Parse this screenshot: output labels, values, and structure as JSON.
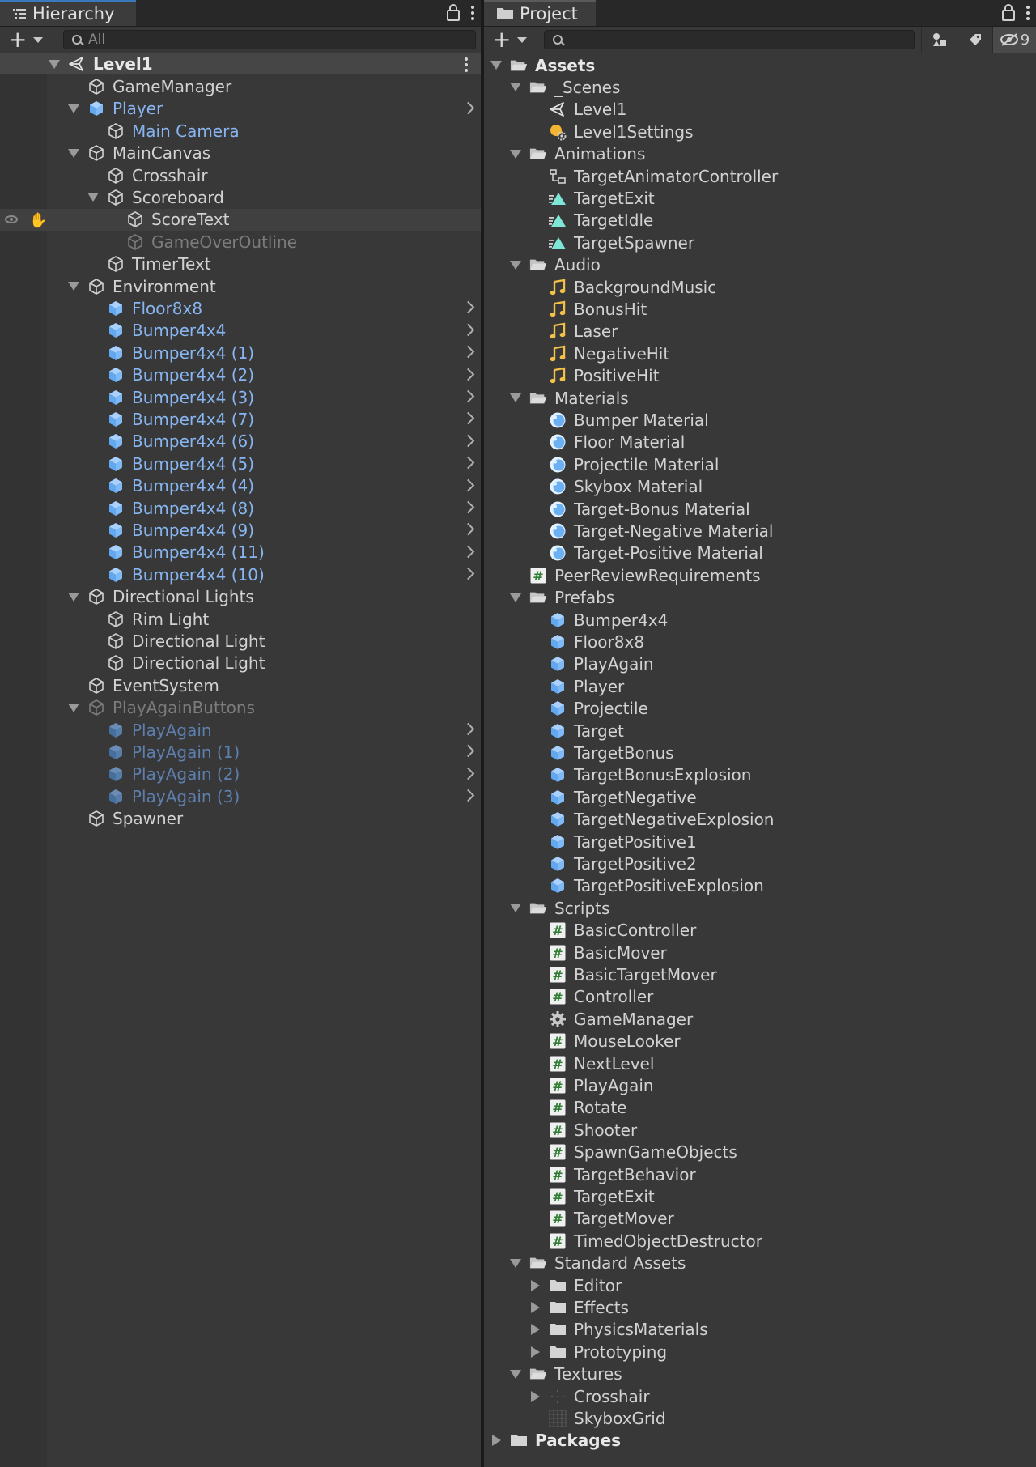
{
  "hierarchy": {
    "tab_label": "Hierarchy",
    "search_placeholder": "All",
    "rows": [
      {
        "label": "Level1",
        "depth": 0,
        "fold": "open",
        "icon": "unity-scene-icon",
        "style": "bold",
        "root": true
      },
      {
        "label": "GameManager",
        "depth": 1,
        "fold": "none",
        "icon": "cube-icon",
        "style": "normal"
      },
      {
        "label": "Player",
        "depth": 1,
        "fold": "open",
        "icon": "prefab-icon",
        "style": "prefab",
        "chevron": true
      },
      {
        "label": "Main Camera",
        "depth": 2,
        "fold": "none",
        "icon": "cube-icon",
        "style": "prefab"
      },
      {
        "label": "MainCanvas",
        "depth": 1,
        "fold": "open",
        "icon": "cube-icon",
        "style": "normal"
      },
      {
        "label": "Crosshair",
        "depth": 2,
        "fold": "none",
        "icon": "cube-icon",
        "style": "normal"
      },
      {
        "label": "Scoreboard",
        "depth": 2,
        "fold": "open",
        "icon": "cube-icon",
        "style": "normal"
      },
      {
        "label": "ScoreText",
        "depth": 3,
        "fold": "none",
        "icon": "cube-icon",
        "style": "normal",
        "hover": true
      },
      {
        "label": "GameOverOutline",
        "depth": 3,
        "fold": "none",
        "icon": "cube-icon",
        "style": "dim"
      },
      {
        "label": "TimerText",
        "depth": 2,
        "fold": "none",
        "icon": "cube-icon",
        "style": "normal"
      },
      {
        "label": "Environment",
        "depth": 1,
        "fold": "open",
        "icon": "cube-icon",
        "style": "normal"
      },
      {
        "label": "Floor8x8",
        "depth": 2,
        "fold": "none",
        "icon": "prefab-icon",
        "style": "prefab",
        "chevron": true
      },
      {
        "label": "Bumper4x4",
        "depth": 2,
        "fold": "none",
        "icon": "prefab-icon",
        "style": "prefab",
        "chevron": true
      },
      {
        "label": "Bumper4x4 (1)",
        "depth": 2,
        "fold": "none",
        "icon": "prefab-icon",
        "style": "prefab",
        "chevron": true
      },
      {
        "label": "Bumper4x4 (2)",
        "depth": 2,
        "fold": "none",
        "icon": "prefab-icon",
        "style": "prefab",
        "chevron": true
      },
      {
        "label": "Bumper4x4 (3)",
        "depth": 2,
        "fold": "none",
        "icon": "prefab-icon",
        "style": "prefab",
        "chevron": true
      },
      {
        "label": "Bumper4x4 (7)",
        "depth": 2,
        "fold": "none",
        "icon": "prefab-icon",
        "style": "prefab",
        "chevron": true
      },
      {
        "label": "Bumper4x4 (6)",
        "depth": 2,
        "fold": "none",
        "icon": "prefab-icon",
        "style": "prefab",
        "chevron": true
      },
      {
        "label": "Bumper4x4 (5)",
        "depth": 2,
        "fold": "none",
        "icon": "prefab-icon",
        "style": "prefab",
        "chevron": true
      },
      {
        "label": "Bumper4x4 (4)",
        "depth": 2,
        "fold": "none",
        "icon": "prefab-icon",
        "style": "prefab",
        "chevron": true
      },
      {
        "label": "Bumper4x4 (8)",
        "depth": 2,
        "fold": "none",
        "icon": "prefab-icon",
        "style": "prefab",
        "chevron": true
      },
      {
        "label": "Bumper4x4 (9)",
        "depth": 2,
        "fold": "none",
        "icon": "prefab-icon",
        "style": "prefab",
        "chevron": true
      },
      {
        "label": "Bumper4x4 (11)",
        "depth": 2,
        "fold": "none",
        "icon": "prefab-icon",
        "style": "prefab",
        "chevron": true
      },
      {
        "label": "Bumper4x4 (10)",
        "depth": 2,
        "fold": "none",
        "icon": "prefab-icon",
        "style": "prefab",
        "chevron": true
      },
      {
        "label": "Directional Lights",
        "depth": 1,
        "fold": "open",
        "icon": "cube-icon",
        "style": "normal"
      },
      {
        "label": "Rim Light",
        "depth": 2,
        "fold": "none",
        "icon": "cube-icon",
        "style": "normal"
      },
      {
        "label": "Directional Light",
        "depth": 2,
        "fold": "none",
        "icon": "cube-icon",
        "style": "normal"
      },
      {
        "label": "Directional Light",
        "depth": 2,
        "fold": "none",
        "icon": "cube-icon",
        "style": "normal"
      },
      {
        "label": "EventSystem",
        "depth": 1,
        "fold": "none",
        "icon": "cube-icon",
        "style": "normal"
      },
      {
        "label": "PlayAgainButtons",
        "depth": 1,
        "fold": "open",
        "icon": "cube-icon",
        "style": "dim"
      },
      {
        "label": "PlayAgain",
        "depth": 2,
        "fold": "none",
        "icon": "prefab-icon",
        "style": "prefab-dim",
        "chevron": true
      },
      {
        "label": "PlayAgain (1)",
        "depth": 2,
        "fold": "none",
        "icon": "prefab-icon",
        "style": "prefab-dim",
        "chevron": true
      },
      {
        "label": "PlayAgain (2)",
        "depth": 2,
        "fold": "none",
        "icon": "prefab-icon",
        "style": "prefab-dim",
        "chevron": true
      },
      {
        "label": "PlayAgain (3)",
        "depth": 2,
        "fold": "none",
        "icon": "prefab-icon",
        "style": "prefab-dim",
        "chevron": true
      },
      {
        "label": "Spawner",
        "depth": 1,
        "fold": "none",
        "icon": "cube-icon",
        "style": "normal"
      }
    ]
  },
  "project": {
    "tab_label": "Project",
    "search_placeholder": "",
    "hidden_count": "9",
    "rows": [
      {
        "label": "Assets",
        "depth": 0,
        "fold": "open",
        "icon": "folder-open-icon",
        "style": "bold"
      },
      {
        "label": "_Scenes",
        "depth": 1,
        "fold": "open",
        "icon": "folder-open-icon",
        "style": "normal"
      },
      {
        "label": "Level1",
        "depth": 2,
        "fold": "none",
        "icon": "unity-scene-icon",
        "style": "normal"
      },
      {
        "label": "Level1Settings",
        "depth": 2,
        "fold": "none",
        "icon": "lighting-settings-icon",
        "style": "normal"
      },
      {
        "label": "Animations",
        "depth": 1,
        "fold": "open",
        "icon": "folder-open-icon",
        "style": "normal"
      },
      {
        "label": "TargetAnimatorController",
        "depth": 2,
        "fold": "none",
        "icon": "animator-controller-icon",
        "style": "normal"
      },
      {
        "label": "TargetExit",
        "depth": 2,
        "fold": "none",
        "icon": "animation-clip-icon",
        "style": "normal"
      },
      {
        "label": "TargetIdle",
        "depth": 2,
        "fold": "none",
        "icon": "animation-clip-icon",
        "style": "normal"
      },
      {
        "label": "TargetSpawner",
        "depth": 2,
        "fold": "none",
        "icon": "animation-clip-icon",
        "style": "normal"
      },
      {
        "label": "Audio",
        "depth": 1,
        "fold": "open",
        "icon": "folder-open-icon",
        "style": "normal"
      },
      {
        "label": "BackgroundMusic",
        "depth": 2,
        "fold": "none",
        "icon": "audio-clip-icon",
        "style": "normal"
      },
      {
        "label": "BonusHit",
        "depth": 2,
        "fold": "none",
        "icon": "audio-clip-icon",
        "style": "normal"
      },
      {
        "label": "Laser",
        "depth": 2,
        "fold": "none",
        "icon": "audio-clip-icon",
        "style": "normal"
      },
      {
        "label": "NegativeHit",
        "depth": 2,
        "fold": "none",
        "icon": "audio-clip-icon",
        "style": "normal"
      },
      {
        "label": "PositiveHit",
        "depth": 2,
        "fold": "none",
        "icon": "audio-clip-icon",
        "style": "normal"
      },
      {
        "label": "Materials",
        "depth": 1,
        "fold": "open",
        "icon": "folder-open-icon",
        "style": "normal"
      },
      {
        "label": "Bumper Material",
        "depth": 2,
        "fold": "none",
        "icon": "material-icon",
        "style": "normal"
      },
      {
        "label": "Floor Material",
        "depth": 2,
        "fold": "none",
        "icon": "material-icon",
        "style": "normal"
      },
      {
        "label": "Projectile Material",
        "depth": 2,
        "fold": "none",
        "icon": "material-icon",
        "style": "normal"
      },
      {
        "label": "Skybox Material",
        "depth": 2,
        "fold": "none",
        "icon": "material-icon",
        "style": "normal"
      },
      {
        "label": "Target-Bonus Material",
        "depth": 2,
        "fold": "none",
        "icon": "material-icon",
        "style": "normal"
      },
      {
        "label": "Target-Negative Material",
        "depth": 2,
        "fold": "none",
        "icon": "material-icon",
        "style": "normal"
      },
      {
        "label": "Target-Positive Material",
        "depth": 2,
        "fold": "none",
        "icon": "material-icon",
        "style": "normal"
      },
      {
        "label": "PeerReviewRequirements",
        "depth": 1,
        "fold": "none",
        "icon": "script-icon",
        "style": "normal"
      },
      {
        "label": "Prefabs",
        "depth": 1,
        "fold": "open",
        "icon": "folder-open-icon",
        "style": "normal"
      },
      {
        "label": "Bumper4x4",
        "depth": 2,
        "fold": "none",
        "icon": "prefab-icon",
        "style": "normal"
      },
      {
        "label": "Floor8x8",
        "depth": 2,
        "fold": "none",
        "icon": "prefab-icon",
        "style": "normal"
      },
      {
        "label": "PlayAgain",
        "depth": 2,
        "fold": "none",
        "icon": "prefab-icon",
        "style": "normal"
      },
      {
        "label": "Player",
        "depth": 2,
        "fold": "none",
        "icon": "prefab-icon",
        "style": "normal"
      },
      {
        "label": "Projectile",
        "depth": 2,
        "fold": "none",
        "icon": "prefab-icon",
        "style": "normal"
      },
      {
        "label": "Target",
        "depth": 2,
        "fold": "none",
        "icon": "prefab-icon",
        "style": "normal"
      },
      {
        "label": "TargetBonus",
        "depth": 2,
        "fold": "none",
        "icon": "prefab-icon",
        "style": "normal"
      },
      {
        "label": "TargetBonusExplosion",
        "depth": 2,
        "fold": "none",
        "icon": "prefab-icon",
        "style": "normal"
      },
      {
        "label": "TargetNegative",
        "depth": 2,
        "fold": "none",
        "icon": "prefab-icon",
        "style": "normal"
      },
      {
        "label": "TargetNegativeExplosion",
        "depth": 2,
        "fold": "none",
        "icon": "prefab-icon",
        "style": "normal"
      },
      {
        "label": "TargetPositive1",
        "depth": 2,
        "fold": "none",
        "icon": "prefab-icon",
        "style": "normal"
      },
      {
        "label": "TargetPositive2",
        "depth": 2,
        "fold": "none",
        "icon": "prefab-icon",
        "style": "normal"
      },
      {
        "label": "TargetPositiveExplosion",
        "depth": 2,
        "fold": "none",
        "icon": "prefab-icon",
        "style": "normal"
      },
      {
        "label": "Scripts",
        "depth": 1,
        "fold": "open",
        "icon": "folder-open-icon",
        "style": "normal"
      },
      {
        "label": "BasicController",
        "depth": 2,
        "fold": "none",
        "icon": "script-icon",
        "style": "normal"
      },
      {
        "label": "BasicMover",
        "depth": 2,
        "fold": "none",
        "icon": "script-icon",
        "style": "normal"
      },
      {
        "label": "BasicTargetMover",
        "depth": 2,
        "fold": "none",
        "icon": "script-icon",
        "style": "normal"
      },
      {
        "label": "Controller",
        "depth": 2,
        "fold": "none",
        "icon": "script-icon",
        "style": "normal"
      },
      {
        "label": "GameManager",
        "depth": 2,
        "fold": "none",
        "icon": "gear-icon",
        "style": "normal"
      },
      {
        "label": "MouseLooker",
        "depth": 2,
        "fold": "none",
        "icon": "script-icon",
        "style": "normal"
      },
      {
        "label": "NextLevel",
        "depth": 2,
        "fold": "none",
        "icon": "script-icon",
        "style": "normal"
      },
      {
        "label": "PlayAgain",
        "depth": 2,
        "fold": "none",
        "icon": "script-icon",
        "style": "normal"
      },
      {
        "label": "Rotate",
        "depth": 2,
        "fold": "none",
        "icon": "script-icon",
        "style": "normal"
      },
      {
        "label": "Shooter",
        "depth": 2,
        "fold": "none",
        "icon": "script-icon",
        "style": "normal"
      },
      {
        "label": "SpawnGameObjects",
        "depth": 2,
        "fold": "none",
        "icon": "script-icon",
        "style": "normal"
      },
      {
        "label": "TargetBehavior",
        "depth": 2,
        "fold": "none",
        "icon": "script-icon",
        "style": "normal"
      },
      {
        "label": "TargetExit",
        "depth": 2,
        "fold": "none",
        "icon": "script-icon",
        "style": "normal"
      },
      {
        "label": "TargetMover",
        "depth": 2,
        "fold": "none",
        "icon": "script-icon",
        "style": "normal"
      },
      {
        "label": "TimedObjectDestructor",
        "depth": 2,
        "fold": "none",
        "icon": "script-icon",
        "style": "normal"
      },
      {
        "label": "Standard Assets",
        "depth": 1,
        "fold": "open",
        "icon": "folder-open-icon",
        "style": "normal"
      },
      {
        "label": "Editor",
        "depth": 2,
        "fold": "closed",
        "icon": "folder-icon",
        "style": "normal"
      },
      {
        "label": "Effects",
        "depth": 2,
        "fold": "closed",
        "icon": "folder-icon",
        "style": "normal"
      },
      {
        "label": "PhysicsMaterials",
        "depth": 2,
        "fold": "closed",
        "icon": "folder-icon",
        "style": "normal"
      },
      {
        "label": "Prototyping",
        "depth": 2,
        "fold": "closed",
        "icon": "folder-icon",
        "style": "normal"
      },
      {
        "label": "Textures",
        "depth": 1,
        "fold": "open",
        "icon": "folder-open-icon",
        "style": "normal"
      },
      {
        "label": "Crosshair",
        "depth": 2,
        "fold": "closed",
        "icon": "texture-dots-icon",
        "style": "normal"
      },
      {
        "label": "SkyboxGrid",
        "depth": 2,
        "fold": "none",
        "icon": "texture-grid-icon",
        "style": "normal"
      },
      {
        "label": "Packages",
        "depth": 0,
        "fold": "closed",
        "icon": "folder-icon",
        "style": "bold"
      }
    ]
  },
  "colors": {
    "prefab": "#88b6f2",
    "accent": "#3a79bb",
    "audio": "#f2c14a",
    "script": "#2e7d32"
  }
}
